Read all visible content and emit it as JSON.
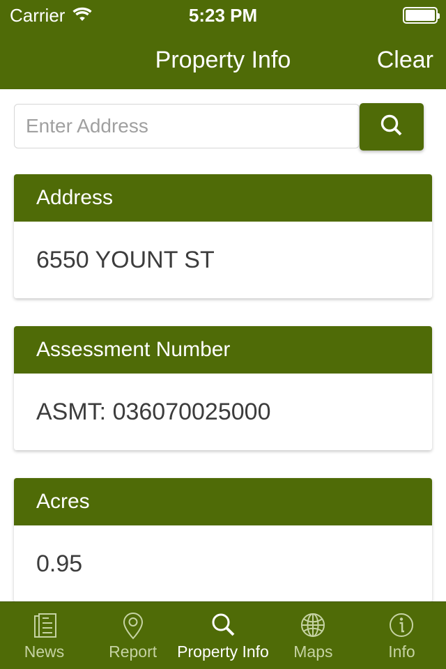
{
  "colors": {
    "brand_green": "#4f6b07",
    "tab_inactive": "#c6d3a3",
    "tab_active": "#ffffff",
    "card_body_text": "#3c3c3c",
    "placeholder": "#a0a0a0"
  },
  "status_bar": {
    "carrier": "Carrier",
    "wifi_icon": "wifi-icon",
    "time": "5:23 PM",
    "battery_icon": "battery-full-icon"
  },
  "navbar": {
    "title": "Property Info",
    "action_label": "Clear"
  },
  "search": {
    "placeholder": "Enter Address",
    "value": "",
    "button_icon": "search-icon"
  },
  "cards": [
    {
      "header": "Address",
      "value": "6550 YOUNT ST"
    },
    {
      "header": "Assessment Number",
      "value": "ASMT: 036070025000"
    },
    {
      "header": "Acres",
      "value": "0.95"
    }
  ],
  "tabbar": {
    "items": [
      {
        "label": "News",
        "icon": "news-document-icon",
        "active": false
      },
      {
        "label": "Report",
        "icon": "map-pin-icon",
        "active": false
      },
      {
        "label": "Property Info",
        "icon": "search-icon",
        "active": true
      },
      {
        "label": "Maps",
        "icon": "globe-icon",
        "active": false
      },
      {
        "label": "Info",
        "icon": "info-circle-icon",
        "active": false
      }
    ]
  }
}
